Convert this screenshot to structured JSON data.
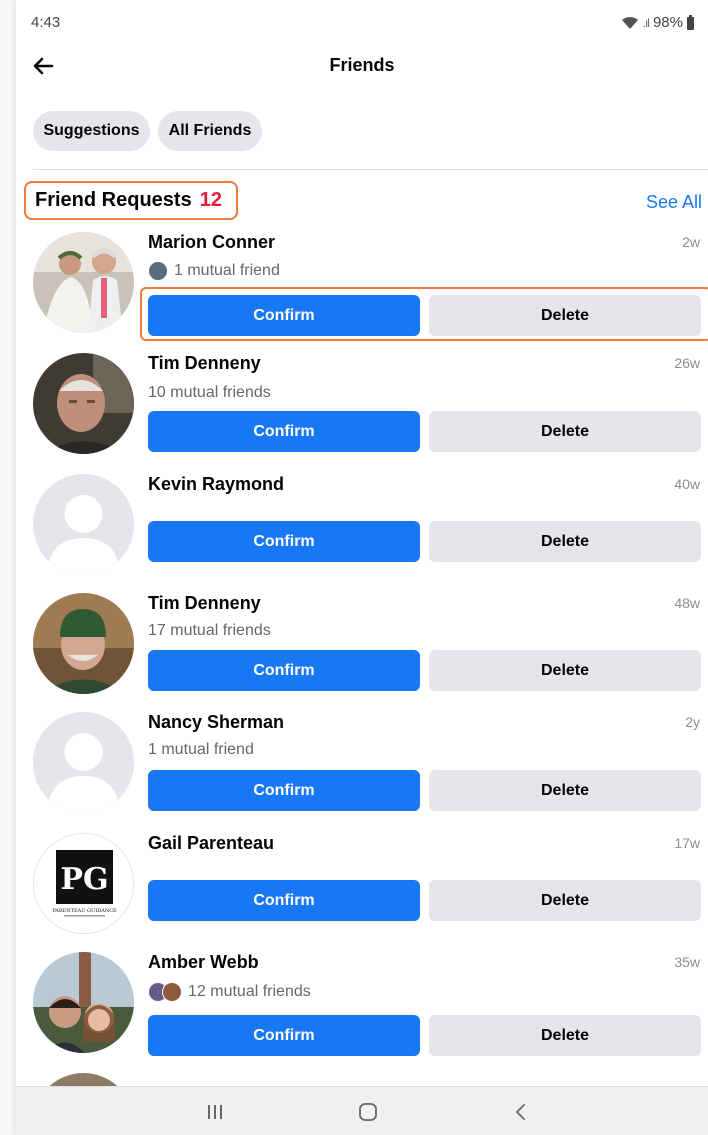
{
  "status": {
    "time": "4:43",
    "battery": "98%"
  },
  "header": {
    "title": "Friends"
  },
  "chips": {
    "suggestions": "Suggestions",
    "all_friends": "All Friends"
  },
  "section": {
    "title": "Friend Requests",
    "count": "12",
    "see_all": "See All"
  },
  "actions": {
    "confirm": "Confirm",
    "delete": "Delete"
  },
  "requests": [
    {
      "name": "Marion Conner",
      "age": "2w",
      "mutual": "1 mutual friend",
      "avatar": "wedding-couple-photo"
    },
    {
      "name": "Tim Denneny",
      "age": "26w",
      "mutual": "10 mutual friends",
      "avatar": "man-selfie-photo"
    },
    {
      "name": "Kevin Raymond",
      "age": "40w",
      "mutual": "",
      "avatar": "default-silhouette"
    },
    {
      "name": "Tim Denneny",
      "age": "48w",
      "mutual": "17 mutual friends",
      "avatar": "man-green-beanie-photo"
    },
    {
      "name": "Nancy Sherman",
      "age": "2y",
      "mutual": "1 mutual friend",
      "avatar": "default-silhouette"
    },
    {
      "name": "Gail Parenteau",
      "age": "17w",
      "mutual": "",
      "avatar": "pg-logo",
      "logo_text": "PG",
      "logo_caption": "PARENTEAU GUIDANCE"
    },
    {
      "name": "Amber Webb",
      "age": "35w",
      "mutual": "12 mutual friends",
      "avatar": "couple-selfie-photo"
    }
  ],
  "colors": {
    "primary": "#1877f2",
    "badge": "#e41e3f",
    "highlight": "#f07a3c",
    "secondary_btn": "#e4e6eb"
  }
}
